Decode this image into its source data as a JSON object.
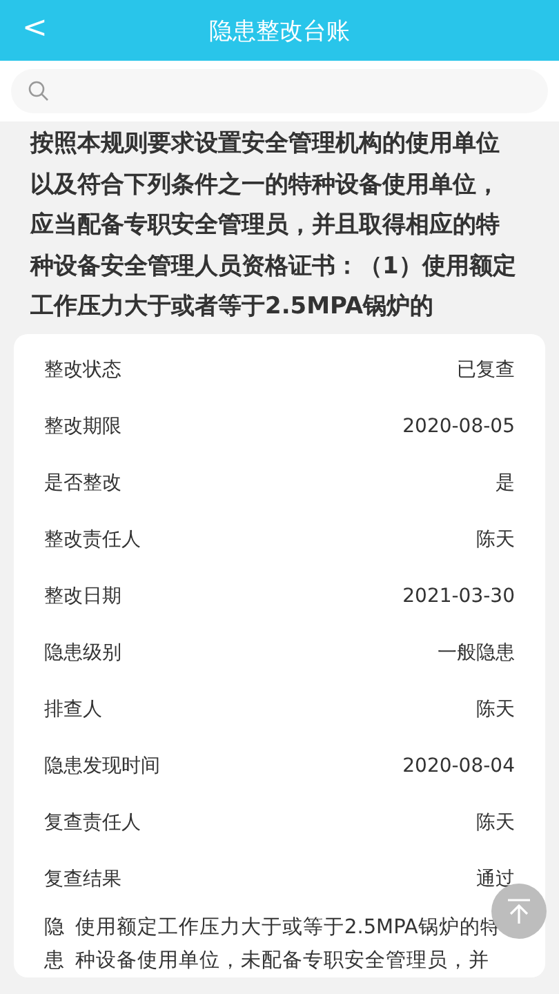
{
  "header": {
    "back": "<",
    "title": "隐患整改台账"
  },
  "notice": "按照本规则要求设置安全管理机构的使用单位以及符合下列条件之一的特种设备使用单位，应当配备专职安全管理员，并且取得相应的特种设备安全管理人员资格证书：（1）使用额定工作压力大于或者等于2.5MPA锅炉的",
  "details": [
    {
      "label": "整改状态",
      "value": "已复查"
    },
    {
      "label": "整改期限",
      "value": "2020-08-05"
    },
    {
      "label": "是否整改",
      "value": "是"
    },
    {
      "label": "整改责任人",
      "value": "陈天"
    },
    {
      "label": "整改日期",
      "value": "2021-03-30"
    },
    {
      "label": "隐患级别",
      "value": "一般隐患"
    },
    {
      "label": "排查人",
      "value": "陈天"
    },
    {
      "label": "隐患发现时间",
      "value": "2020-08-04"
    },
    {
      "label": "复查责任人",
      "value": "陈天"
    },
    {
      "label": "复查结果",
      "value": "通过"
    }
  ],
  "description": {
    "label": "隐患",
    "text": "使用额定工作压力大于或等于2.5MPA锅炉的特种设备使用单位，未配备专职安全管理员，并"
  }
}
